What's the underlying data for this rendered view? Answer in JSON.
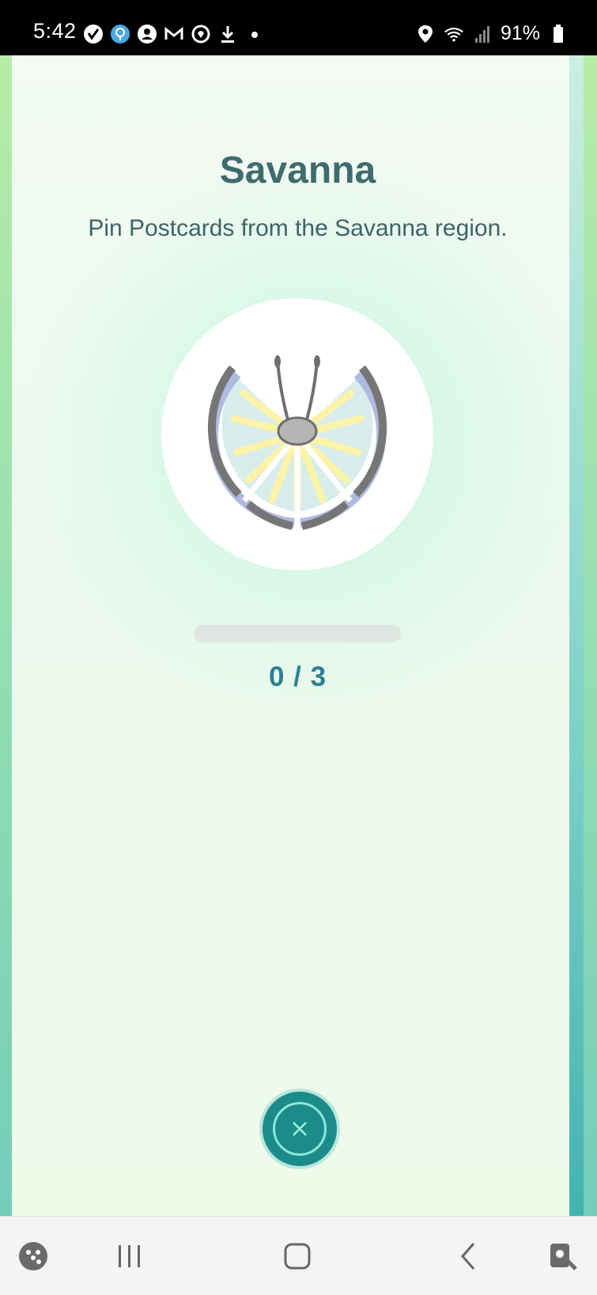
{
  "status_bar": {
    "time": "5:42",
    "battery": "91%",
    "left_icons": [
      "verified-check-icon",
      "pokemon-go-plus-icon",
      "account-icon",
      "gmail-icon",
      "sync-heart-icon",
      "download-icon",
      "dot-icon"
    ],
    "right_icons": [
      "location-icon",
      "wifi-icon",
      "signal-icon",
      "battery-icon"
    ]
  },
  "main": {
    "title": "Savanna",
    "subtitle": "Pin Postcards from the Savanna region.",
    "badge_icon": "butterfly-wing-badge-icon",
    "progress": {
      "current": 0,
      "total": 3,
      "text": "0 / 3",
      "fraction": 0
    },
    "close_icon": "close-icon"
  },
  "nav_bar": {
    "items": [
      "game-launcher-icon",
      "recent-apps-icon",
      "home-icon",
      "back-icon",
      "assistant-icon"
    ]
  },
  "colors": {
    "title": "#3e6b6e",
    "progress_text": "#2b7f94",
    "close_button": "#1c8c8b"
  }
}
